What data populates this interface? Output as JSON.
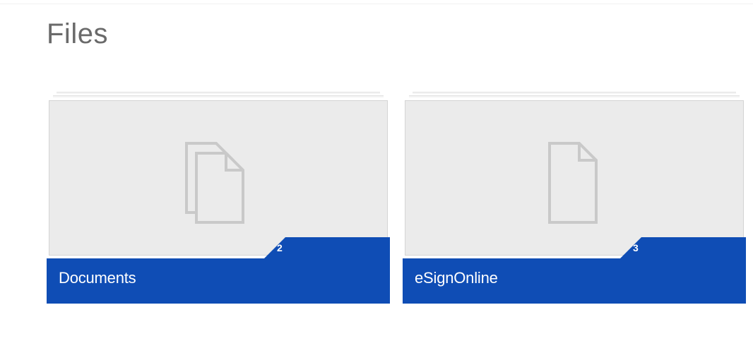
{
  "page": {
    "title": "Files"
  },
  "tiles": [
    {
      "label": "Documents",
      "count": "2",
      "icon": "documents-stack-icon"
    },
    {
      "label": "eSignOnline",
      "count": "3",
      "icon": "document-icon"
    }
  ],
  "colors": {
    "accent": "#0f4db5",
    "thumb_bg": "#ebebeb",
    "icon_stroke": "#c9c9c9",
    "title_text": "#6a6a6a"
  }
}
